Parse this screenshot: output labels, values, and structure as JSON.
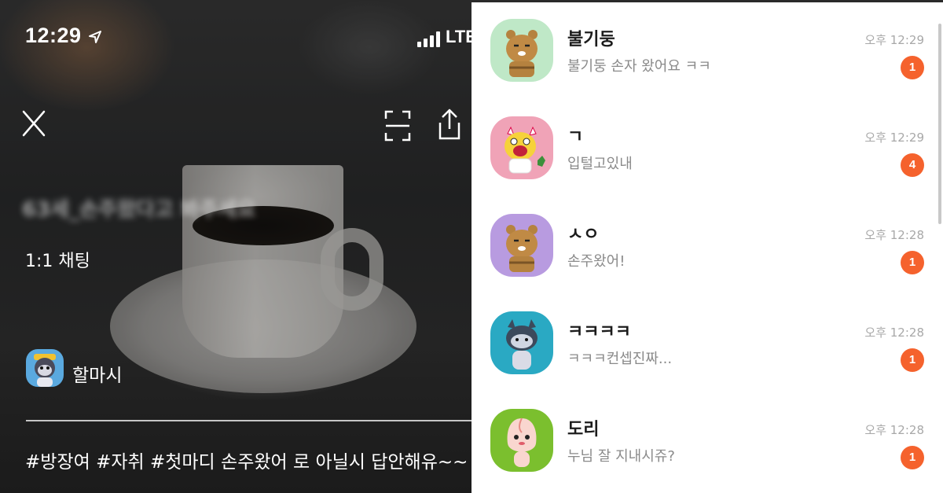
{
  "left_panel": {
    "status_bar": {
      "time": "12:29",
      "network": "LTE"
    },
    "blurred_title": "63세_손주왔다고 봐주세요",
    "chat_type": "1:1 채팅",
    "host": {
      "name": "할마시"
    },
    "hashtags": "#방장여 #자취 #첫마디 손주왔어 로 아닐시 답안해유~~"
  },
  "chat_list": {
    "badge_color": "#f5622d",
    "items": [
      {
        "name": "불기둥",
        "message": "불기둥 손자 왔어요 ㅋㅋ",
        "time": "오후 12:29",
        "unread": "1",
        "avatar_bg": "#bfe8c7",
        "avatar_icon": "ryan-character-icon"
      },
      {
        "name": "ㄱ",
        "message": "입털고있내",
        "time": "오후 12:29",
        "unread": "4",
        "avatar_bg": "#f0a3b7",
        "avatar_icon": "muzi-character-icon"
      },
      {
        "name": "ㅅㅇ",
        "message": "손주왔어!",
        "time": "오후 12:28",
        "unread": "1",
        "avatar_bg": "#b89be0",
        "avatar_icon": "ryan-character-icon"
      },
      {
        "name": "ㅋㅋㅋㅋ",
        "message": "ㅋㅋㅋ컨셉진짜...",
        "time": "오후 12:28",
        "unread": "1",
        "avatar_bg": "#2aa9c3",
        "avatar_icon": "neo-character-icon"
      },
      {
        "name": "도리",
        "message": "누님 잘 지내시쥬?",
        "time": "오후 12:28",
        "unread": "1",
        "avatar_bg": "#7bbf2e",
        "avatar_icon": "apeach-character-icon"
      }
    ]
  }
}
